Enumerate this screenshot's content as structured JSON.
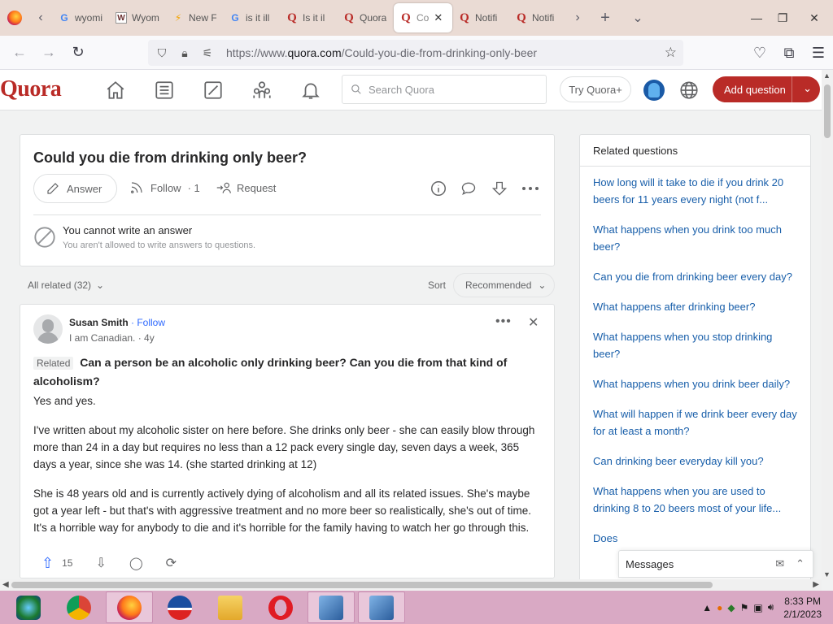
{
  "browser": {
    "tabs": [
      {
        "favicon": "google-icon",
        "label": "wyomi"
      },
      {
        "favicon": "wyoming-icon",
        "label": "Wyom"
      },
      {
        "favicon": "web-icon",
        "label": "New F"
      },
      {
        "favicon": "google-icon",
        "label": "is it ill"
      },
      {
        "favicon": "quora-icon",
        "label": "Is it il"
      },
      {
        "favicon": "quora-icon",
        "label": "Quora"
      },
      {
        "favicon": "quora-icon",
        "label": "Co",
        "active": true
      },
      {
        "favicon": "quora-icon",
        "label": "Notifi"
      },
      {
        "favicon": "quora-icon",
        "label": "Notifi"
      }
    ],
    "url_prefix": "https://www.",
    "url_domain": "quora.com",
    "url_path": "/Could-you-die-from-drinking-only-beer"
  },
  "quora_header": {
    "logo": "Quora",
    "search_placeholder": "Search Quora",
    "try_plus": "Try Quora+",
    "add_question": "Add question"
  },
  "question": {
    "title": "Could you die from drinking only beer?",
    "answer_label": "Answer",
    "follow_label": "Follow",
    "follow_count": "· 1",
    "request_label": "Request",
    "cannot_answer_title": "You cannot write an answer",
    "cannot_answer_sub": "You aren't allowed to write answers to questions."
  },
  "feed": {
    "all_related": "All related (32)",
    "sort_label": "Sort",
    "sort_value": "Recommended"
  },
  "answer": {
    "author": "Susan Smith",
    "follow": "· Follow",
    "credential": "I am Canadian. · 4y",
    "related_tag": "Related",
    "related_question": "Can a person be an alcoholic only drinking beer? Can you die from that kind of alcoholism?",
    "paragraphs": [
      "Yes and yes.",
      "I've written about my alcoholic sister on here before. She drinks only beer - she can easily blow through more than 24 in a day but requires no less than a 12 pack every single day, seven days a week, 365 days a year, since she was 14. (she started drinking at 12)",
      "She is 48 years old and is currently actively dying of alcoholism and all its related issues. She's maybe got a year left - but that's with aggressive treatment and no more beer so realistically, she's out of time. It's a horrible way for anybody to die and it's horrible for the family having to watch her go through this."
    ],
    "upvotes": "15"
  },
  "related_panel": {
    "title": "Related questions",
    "items": [
      "How long will it take to die if you drink 20 beers for 11 years every night (not f...",
      "What happens when you drink too much beer?",
      "Can you die from drinking beer every day?",
      "What happens after drinking beer?",
      "What happens when you stop drinking beer?",
      "What happens when you drink beer daily?",
      "What will happen if we drink beer every day for at least a month?",
      "Can drinking beer everyday kill you?",
      "What happens when you are used to drinking 8 to 20 beers most of your life...",
      "Does"
    ]
  },
  "messages": {
    "label": "Messages"
  },
  "taskbar": {
    "time": "8:33 PM",
    "date": "2/1/2023"
  },
  "colors": {
    "quora_red": "#b92b27",
    "link_blue": "#195faa",
    "tab_bar": "#eadbd4",
    "taskbar": "#d9a9c4"
  }
}
